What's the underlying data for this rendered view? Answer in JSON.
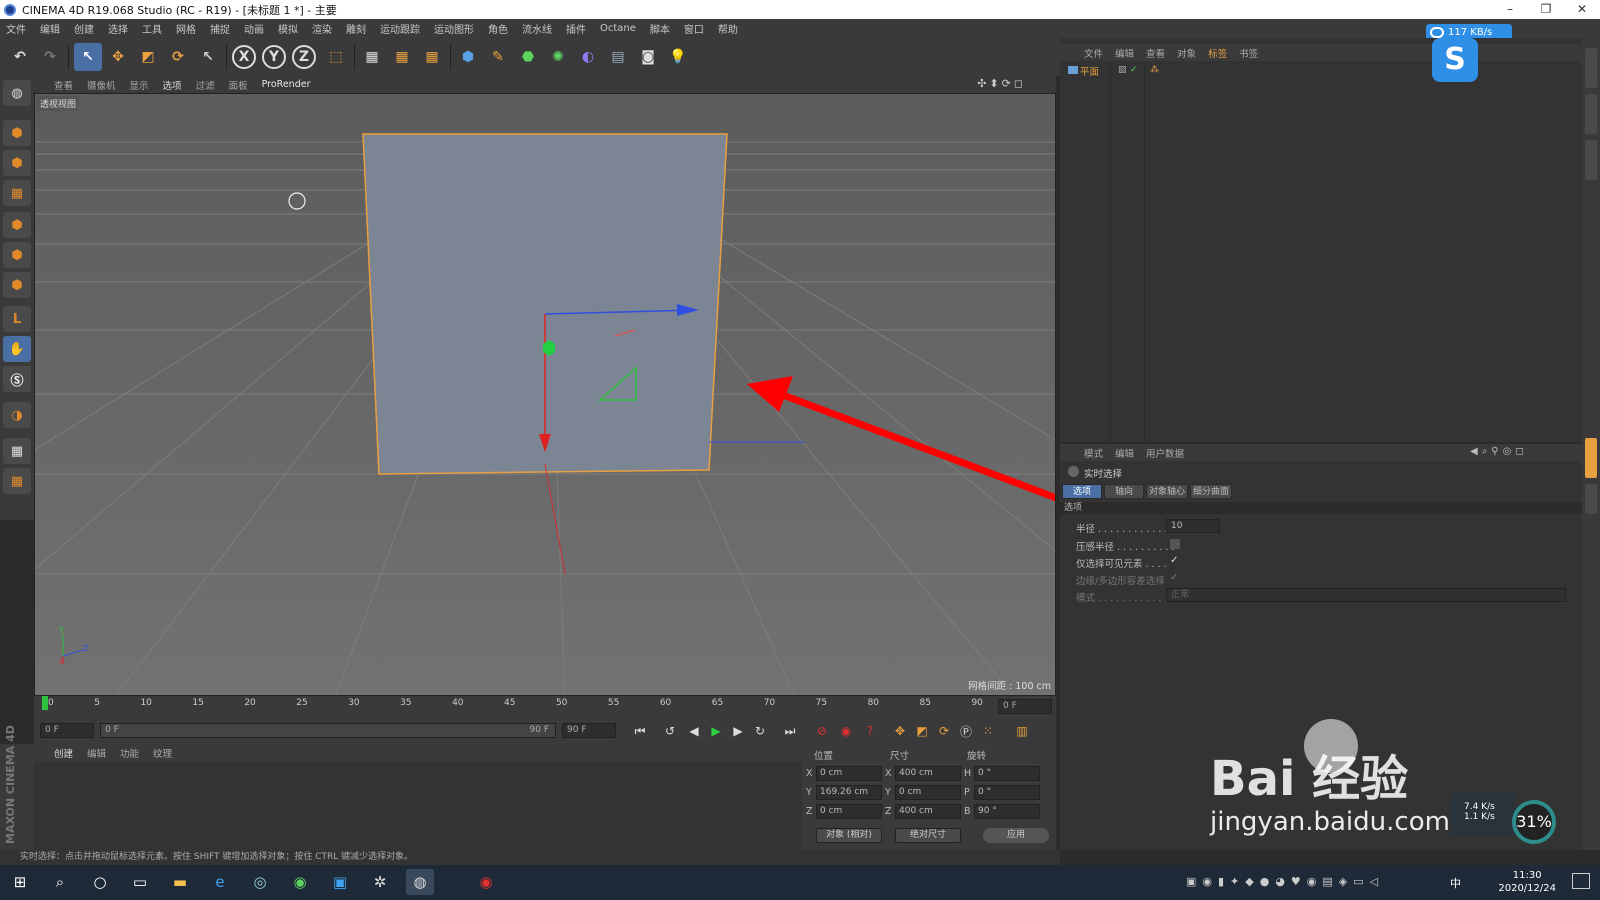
{
  "titlebar": {
    "title": "CINEMA 4D R19.068 Studio (RC - R19) - [未标题 1 *] - 主要",
    "minimize": "–",
    "restore": "❐",
    "close": "✕"
  },
  "menubar": [
    "文件",
    "编辑",
    "创建",
    "选择",
    "工具",
    "网格",
    "捕捉",
    "动画",
    "模拟",
    "渲染",
    "雕刻",
    "运动跟踪",
    "运动图形",
    "角色",
    "流水线",
    "插件",
    "Octane",
    "脚本",
    "窗口",
    "帮助"
  ],
  "netspeed": "117 KB/s",
  "viewport": {
    "menu": [
      "查看",
      "摄像机",
      "显示",
      "选项",
      "过滤",
      "面板"
    ],
    "active_menu": "选项",
    "prorender": "ProRender",
    "title": "透视视图",
    "grid_info": "网格间距 : 100 cm",
    "icons": "✣⬍⟳◻",
    "axis_labels": {
      "y": "Y",
      "z": "Z",
      "x": "X"
    }
  },
  "timeline": {
    "ticks": [
      "0",
      "5",
      "10",
      "15",
      "20",
      "25",
      "30",
      "35",
      "40",
      "45",
      "50",
      "55",
      "60",
      "65",
      "70",
      "75",
      "80",
      "85",
      "90"
    ],
    "current_frame": "0 F"
  },
  "playbar": {
    "start": "0 F",
    "range_start": "0 F",
    "range_end": "90 F",
    "end": "90 F"
  },
  "material": {
    "menu": [
      "创建",
      "编辑",
      "功能",
      "纹理"
    ],
    "active": "创建"
  },
  "maxon_logo": "MAXON CINEMA 4D",
  "coords": {
    "headers": {
      "position": "位置",
      "size": "尺寸",
      "rotation": "旋转"
    },
    "rows": [
      {
        "axis": "X",
        "pos": "0 cm",
        "saxis": "X",
        "size": "400 cm",
        "raxis": "H",
        "rot": "0 °"
      },
      {
        "axis": "Y",
        "pos": "169.26 cm",
        "saxis": "Y",
        "size": "0 cm",
        "raxis": "P",
        "rot": "0 °"
      },
      {
        "axis": "Z",
        "pos": "0 cm",
        "saxis": "Z",
        "size": "400 cm",
        "raxis": "B",
        "rot": "90 °"
      }
    ],
    "mode": "对象 (相对)",
    "size_mode": "绝对尺寸",
    "apply": "应用"
  },
  "status": "实时选择：点击并拖动鼠标选择元素。按住 SHIFT 键增加选择对象；按住 CTRL 键减少选择对象。",
  "objmgr": {
    "menu": [
      "文件",
      "编辑",
      "查看",
      "对象",
      "标签",
      "书签"
    ],
    "active": "标签",
    "object": "平面"
  },
  "attrmgr": {
    "menu": [
      "模式",
      "编辑",
      "用户数据"
    ],
    "title": "实时选择",
    "tabs": [
      "选项",
      "轴向",
      "对象轴心",
      "细分曲面"
    ],
    "section": "选项",
    "props": [
      {
        "label": "半径 . . . . . . . . . . . . .",
        "value": "10"
      },
      {
        "label": "压感半径 . . . . . . . . . ."
      },
      {
        "label": "仅选择可见元素 . . . ."
      },
      {
        "label": "边缘/多边形容差选择"
      },
      {
        "label": "模式 . . . . . . . . . . . . .",
        "value": "正常"
      }
    ]
  },
  "taskbar": {
    "time": "11:30",
    "date": "2020/12/24",
    "ime": "中"
  },
  "watermark": {
    "brand": "Bai  经验",
    "url": "jingyan.baidu.com"
  },
  "speed": {
    "up": "7.4 K/s",
    "down": "1.1 K/s"
  },
  "gauge": "31%",
  "colors": {
    "accent": "#e8a040",
    "selection": "#4a6fa5",
    "annotation_arrow": "#ff0000"
  }
}
